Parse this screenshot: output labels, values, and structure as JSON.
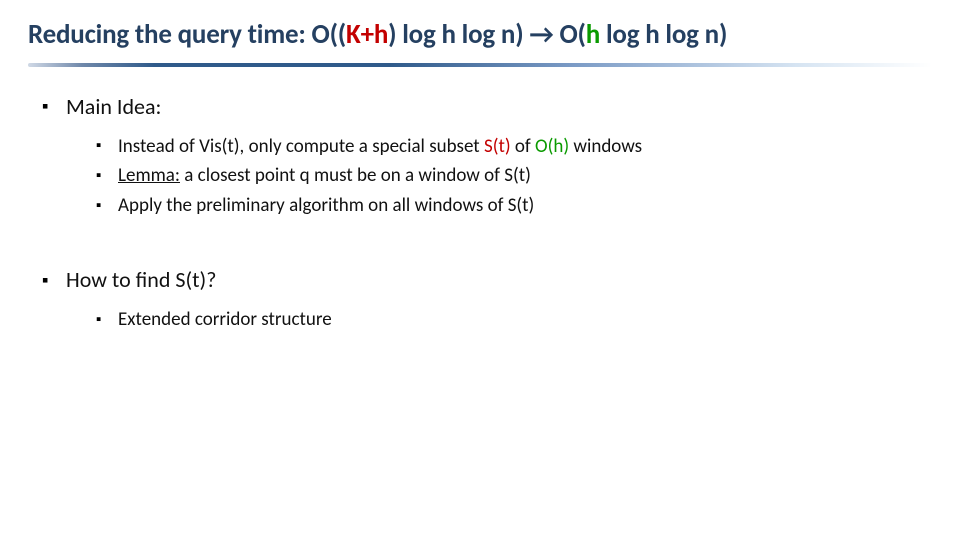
{
  "title": {
    "t1": "Reducing the query time: O((",
    "kplush": "K+h",
    "t2": ") log h log n) ",
    "arrow": "→",
    "t3": " O(",
    "h2": "h",
    "t4": " log h log n)"
  },
  "body": {
    "main_idea_label": "Main Idea:",
    "sub1": {
      "a": "Instead of Vis(t), only compute a special subset ",
      "st": "S(t)",
      "b": " of ",
      "oh": "O(h)",
      "c": " windows"
    },
    "sub2": {
      "lemma": "Lemma:",
      "rest": " a closest point q must be on a window of S(t)"
    },
    "sub3": "Apply the preliminary algorithm on all windows of S(t)",
    "howto": "How to find S(t)?",
    "ext": "Extended corridor structure"
  }
}
